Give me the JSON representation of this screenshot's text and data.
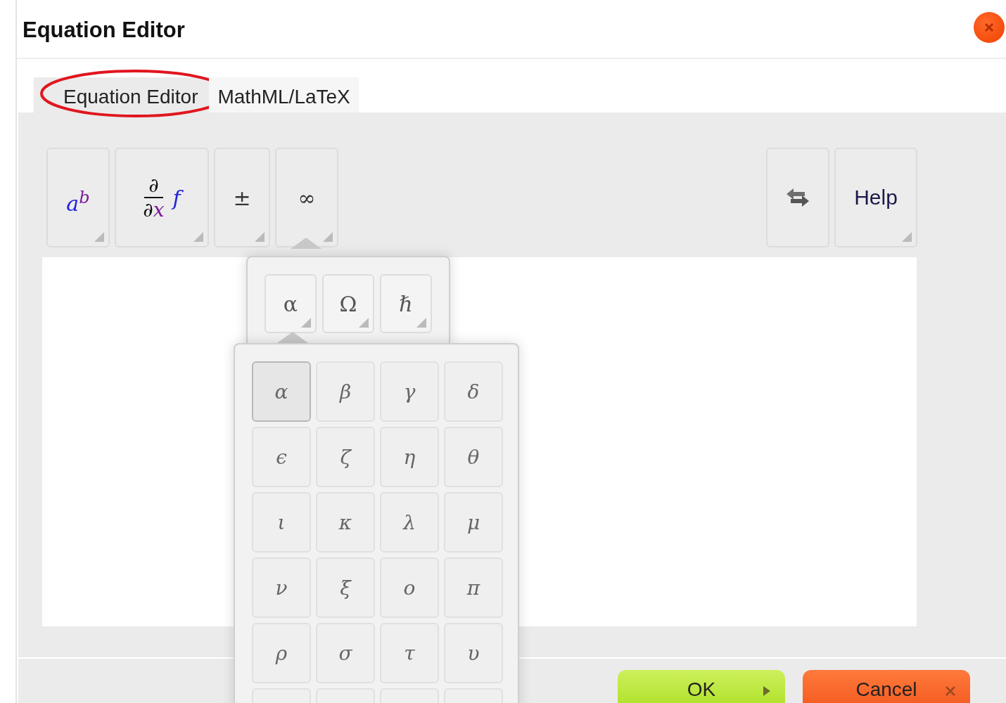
{
  "dialog": {
    "title": "Equation Editor"
  },
  "tabs": [
    {
      "label": "Equation Editor",
      "selected": true,
      "annotated": true
    },
    {
      "label": "MathML/LaTeX",
      "selected": false,
      "annotated": false
    }
  ],
  "toolbar_left": [
    {
      "kind": "power",
      "base": "a",
      "exponent": "b",
      "has_menu": true,
      "open": false
    },
    {
      "kind": "derivative",
      "numerator": "∂",
      "denominator": "∂",
      "variable": "x",
      "function": "f",
      "has_menu": true,
      "open": false
    },
    {
      "kind": "symbol",
      "symbol": "±",
      "has_menu": true,
      "open": false
    },
    {
      "kind": "symbol",
      "symbol": "∞",
      "has_menu": true,
      "open": true
    }
  ],
  "toolbar_right": [
    {
      "kind": "swap",
      "has_menu": false
    },
    {
      "kind": "text",
      "label": "Help",
      "has_menu": true
    }
  ],
  "symbol_menu": {
    "groups": [
      {
        "symbol": "α",
        "open": true
      },
      {
        "symbol": "Ω",
        "open": false
      },
      {
        "symbol": "ℏ",
        "open": false
      }
    ],
    "letters": [
      {
        "symbol": "α",
        "selected": true
      },
      {
        "symbol": "β",
        "selected": false
      },
      {
        "symbol": "γ",
        "selected": false
      },
      {
        "symbol": "δ",
        "selected": false
      },
      {
        "symbol": "ϵ",
        "selected": false
      },
      {
        "symbol": "ζ",
        "selected": false
      },
      {
        "symbol": "η",
        "selected": false
      },
      {
        "symbol": "θ",
        "selected": false
      },
      {
        "symbol": "ι",
        "selected": false
      },
      {
        "symbol": "κ",
        "selected": false
      },
      {
        "symbol": "λ",
        "selected": false
      },
      {
        "symbol": "μ",
        "selected": false
      },
      {
        "symbol": "ν",
        "selected": false
      },
      {
        "symbol": "ξ",
        "selected": false
      },
      {
        "symbol": "ο",
        "selected": false
      },
      {
        "symbol": "π",
        "selected": false
      },
      {
        "symbol": "ρ",
        "selected": false
      },
      {
        "symbol": "σ",
        "selected": false
      },
      {
        "symbol": "τ",
        "selected": false
      },
      {
        "symbol": "υ",
        "selected": false
      }
    ]
  },
  "buttons": [
    {
      "kind": "ok",
      "label": "OK"
    },
    {
      "kind": "cancel",
      "label": "Cancel"
    }
  ]
}
